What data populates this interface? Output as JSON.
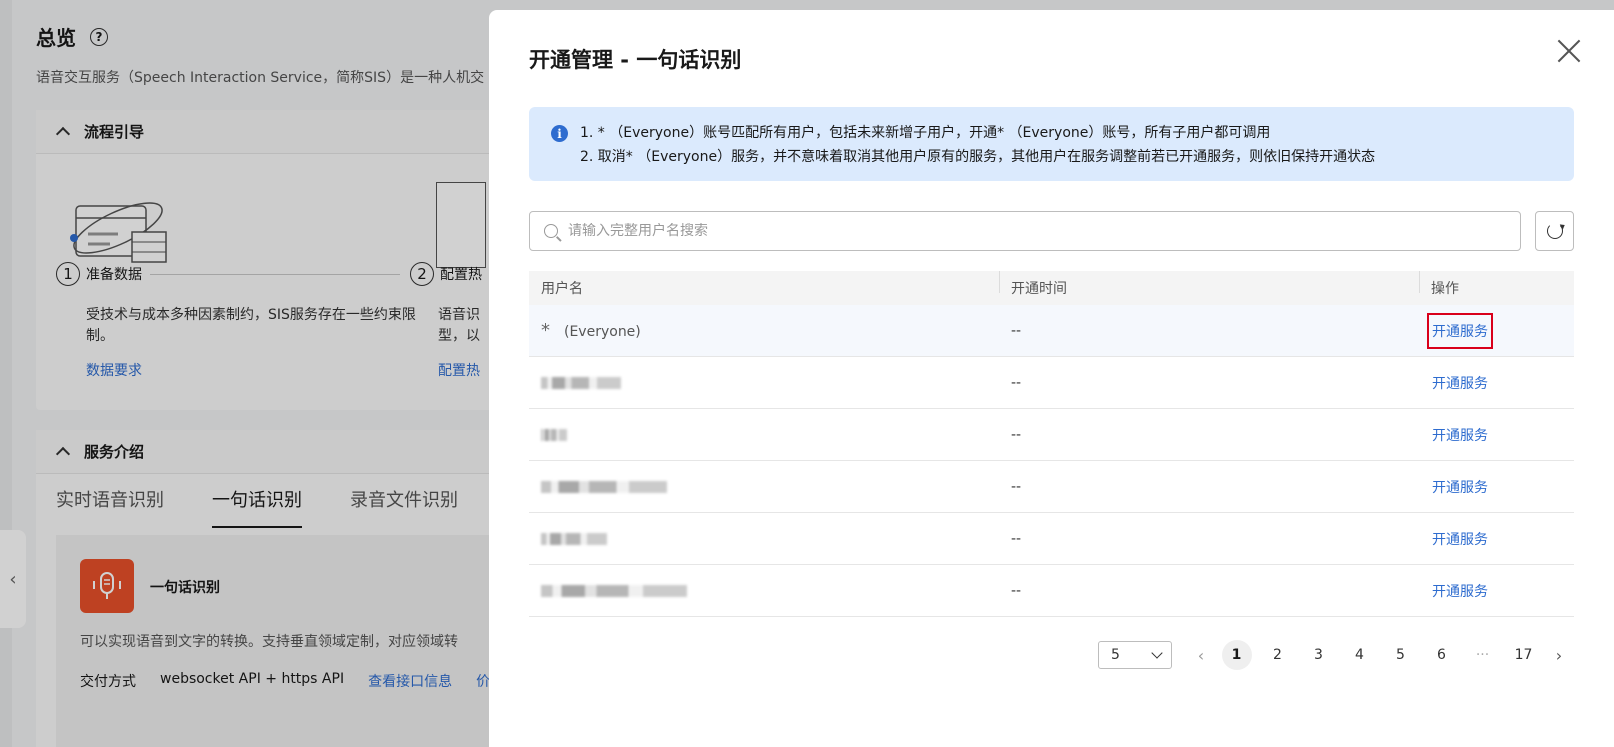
{
  "background": {
    "title": "总览",
    "description": "语音交互服务（Speech Interaction Service，简称SIS）是一种人机交",
    "guide": {
      "title": "流程引导",
      "step1": {
        "num": "1",
        "label": "准备数据",
        "text": "受技术与成本多种因素制约，SIS服务存在一些约束限制。",
        "link": "数据要求"
      },
      "step2": {
        "num": "2",
        "label": "配置热",
        "text_frag1": "语音识",
        "text_frag2": "型，以",
        "link": "配置热"
      }
    },
    "service": {
      "title": "服务介绍",
      "tabs": [
        "实时语音识别",
        "一句话识别",
        "录音文件识别"
      ],
      "active_tab": "一句话识别",
      "product_name": "一句话识别",
      "product_desc": "可以实现语音到文字的转换。支持垂直领域定制，对应领域转",
      "delivery_label": "交付方式",
      "delivery_value": "websocket API + https API",
      "delivery_link": "查看接口信息",
      "delivery_link2": "价"
    }
  },
  "drawer": {
    "title": "开通管理 - 一句话识别",
    "alert": {
      "line1": "1. * （Everyone）账号匹配所有用户，包括未来新增子用户，开通* （Everyone）账号，所有子用户都可调用",
      "line2": "2. 取消* （Everyone）服务，并不意味着取消其他用户原有的服务，其他用户在服务调整前若已开通服务，则依旧保持开通状态"
    },
    "search": {
      "placeholder": "请输入完整用户名搜索",
      "value": ""
    },
    "table": {
      "headers": {
        "username": "用户名",
        "time": "开通时间",
        "action": "操作"
      },
      "everyone_star": "*",
      "everyone_name": "(Everyone)",
      "rows": [
        {
          "time": "--",
          "action": "开通服务"
        },
        {
          "time": "--",
          "action": "开通服务"
        },
        {
          "time": "--",
          "action": "开通服务"
        },
        {
          "time": "--",
          "action": "开通服务"
        },
        {
          "time": "--",
          "action": "开通服务"
        },
        {
          "time": "--",
          "action": "开通服务"
        }
      ]
    },
    "pagination": {
      "page_size": "5",
      "pages": [
        "1",
        "2",
        "3",
        "4",
        "5",
        "6"
      ],
      "ellipsis": "···",
      "last_page": "17",
      "current": "1"
    }
  },
  "colors": {
    "link": "#2e6ccf",
    "alert_bg": "#dbeafd",
    "highlight_border": "#d9001b",
    "product_logo": "#e8502a"
  }
}
